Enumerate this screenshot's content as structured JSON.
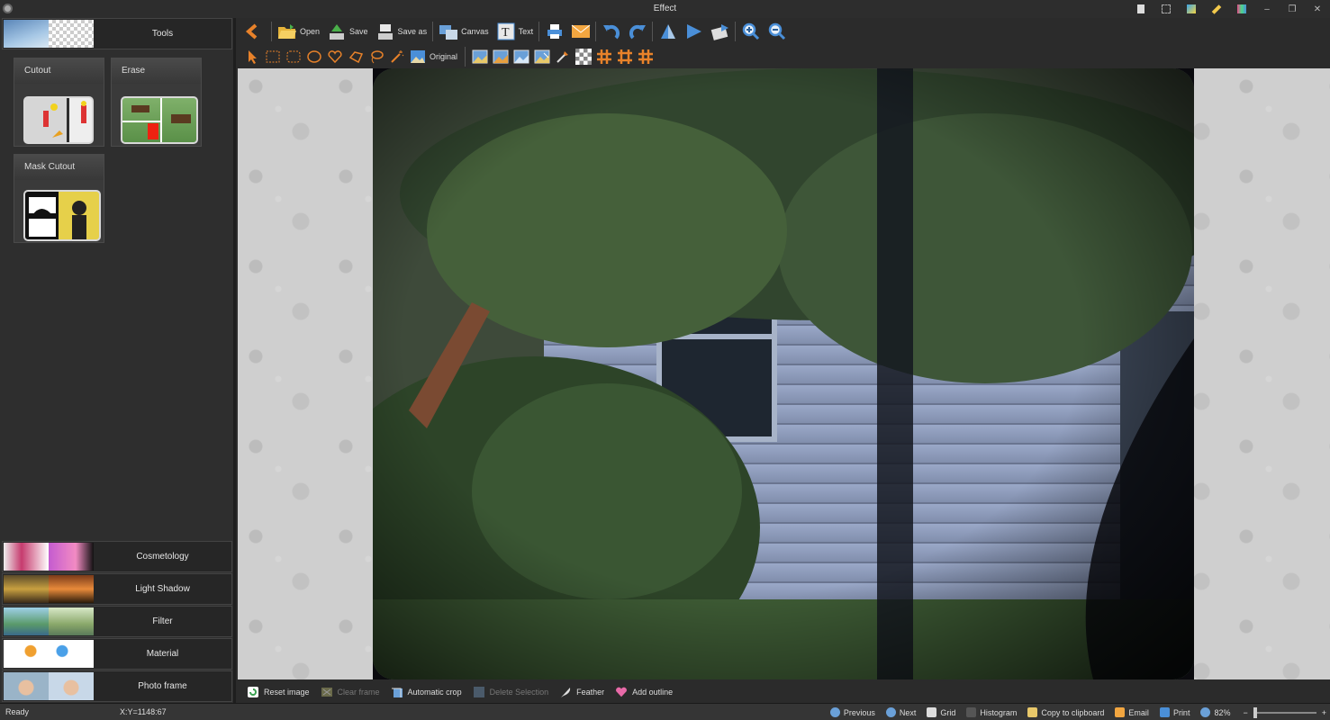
{
  "window": {
    "title": "Effect"
  },
  "left_panel": {
    "tools_label": "Tools",
    "tool_cards": [
      {
        "label": "Cutout"
      },
      {
        "label": "Erase"
      },
      {
        "label": "Mask Cutout"
      }
    ],
    "categories": [
      {
        "label": "Cosmetology"
      },
      {
        "label": "Light Shadow"
      },
      {
        "label": "Filter"
      },
      {
        "label": "Material"
      },
      {
        "label": "Photo frame"
      }
    ]
  },
  "toolbar": {
    "open": "Open",
    "save": "Save",
    "save_as": "Save as",
    "canvas": "Canvas",
    "text": "Text",
    "original": "Original"
  },
  "bottom_actions": {
    "reset_image": "Reset image",
    "clear_frame": "Clear frame",
    "automatic_crop": "Automatic crop",
    "delete_selection": "Delete Selection",
    "feather": "Feather",
    "add_outline": "Add outline"
  },
  "status": {
    "state": "Ready",
    "coords": "X:Y=1148:67",
    "previous": "Previous",
    "next": "Next",
    "grid": "Grid",
    "histogram": "Histogram",
    "copy": "Copy to clipboard",
    "email": "Email",
    "print": "Print",
    "zoom": "82%",
    "zoom_minus": "−",
    "zoom_plus": "+"
  },
  "colors": {
    "accent_orange": "#e8822a",
    "accent_blue": "#4a8fd8",
    "panel": "#2e2e2e"
  }
}
